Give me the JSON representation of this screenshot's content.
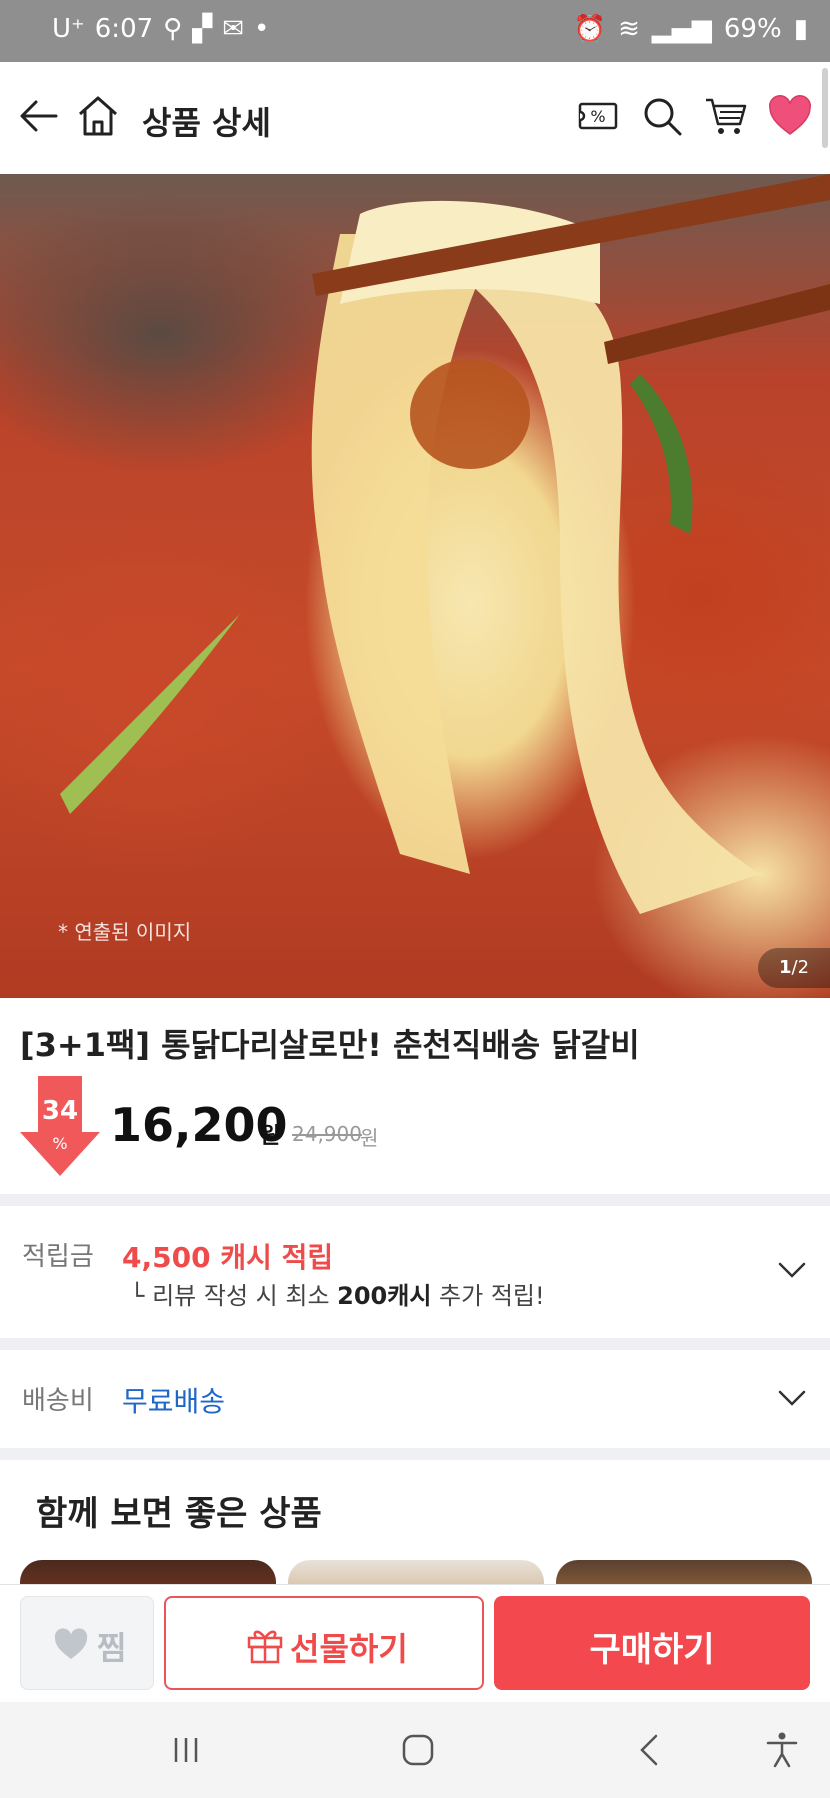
{
  "status_bar": {
    "carrier": "U⁺",
    "time": "6:07",
    "battery": "69%"
  },
  "app_bar": {
    "title": "상품 상세",
    "coupon_badge": "%"
  },
  "hero": {
    "note": "* 연출된 이미지",
    "page_current": "1",
    "page_total": "/2"
  },
  "product": {
    "title": "[3+1팩] 통닭다리살로만! 춘천직배송 닭갈비",
    "discount": "34",
    "discount_unit": "%",
    "price": "16,200",
    "price_unit": "원",
    "original_price": "24,900",
    "original_unit": "원"
  },
  "points": {
    "label": "적립금",
    "value": "4,500 캐시 적립",
    "sub_prefix": "└ 리뷰 작성 시 최소 ",
    "sub_bold": "200캐시",
    "sub_suffix": " 추가 적립!"
  },
  "shipping": {
    "label": "배송비",
    "value": "무료배송"
  },
  "recommend": {
    "title": "함께 보면 좋은 상품"
  },
  "actions": {
    "zzim": "찜",
    "gift": "선물하기",
    "buy": "구매하기"
  },
  "colors": {
    "accent": "#f2484e",
    "discount": "#f0585a",
    "shipping": "#1e66c7",
    "heart": "#ef4f7b"
  }
}
